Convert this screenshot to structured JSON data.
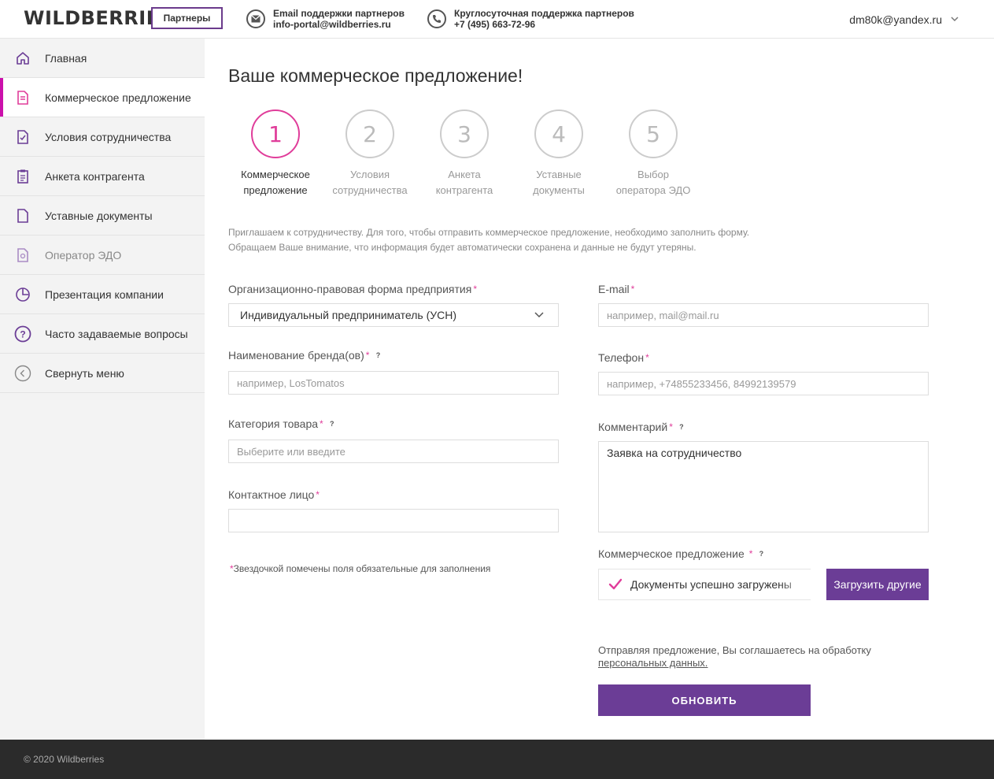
{
  "header": {
    "logo": "WILDBERRIES",
    "partners_label": "Партнеры",
    "email_title": "Email поддержки партнеров",
    "email_value": "info-portal@wildberries.ru",
    "phone_title": "Круглосуточная поддержка партнеров",
    "phone_value": "+7 (495) 663-72-96",
    "user": "dm80k@yandex.ru"
  },
  "sidebar": {
    "items": [
      {
        "label": "Главная",
        "icon": "home-icon"
      },
      {
        "label": "Коммерческое предложение",
        "icon": "document-icon"
      },
      {
        "label": "Условия сотрудничества",
        "icon": "checklist-icon"
      },
      {
        "label": "Анкета контрагента",
        "icon": "clipboard-icon"
      },
      {
        "label": "Уставные документы",
        "icon": "file-icon"
      },
      {
        "label": "Оператор ЭДО",
        "icon": "edo-icon"
      },
      {
        "label": "Презентация компании",
        "icon": "pie-chart-icon"
      },
      {
        "label": "Часто задаваемые вопросы",
        "icon": "question-icon"
      },
      {
        "label": "Свернуть меню",
        "icon": "collapse-icon"
      }
    ]
  },
  "main": {
    "title": "Ваше коммерческое предложение!",
    "steps": [
      {
        "num": "1",
        "line1": "Коммерческое",
        "line2": "предложение"
      },
      {
        "num": "2",
        "line1": "Условия",
        "line2": "сотрудничества"
      },
      {
        "num": "3",
        "line1": "Анкета",
        "line2": "контрагента"
      },
      {
        "num": "4",
        "line1": "Уставные",
        "line2": "документы"
      },
      {
        "num": "5",
        "line1": "Выбор",
        "line2": "оператора ЭДО"
      }
    ],
    "intro_line1": "Приглашаем к сотрудничеству. Для того, чтобы отправить коммерческое предложение, необходимо заполнить форму.",
    "intro_line2": "Обращаем Ваше внимание, что информация будет автоматически сохранена и данные не будут утеряны."
  },
  "form": {
    "org_form_label": "Организационно-правовая форма предприятия",
    "org_form_value": "Индивидуальный предприниматель (УСН)",
    "brand_label": "Наименование бренда(ов)",
    "brand_placeholder": "например, LosTomatos",
    "category_label": "Категория товара",
    "category_placeholder": "Выберите или введите",
    "contact_label": "Контактное лицо",
    "contact_value": "",
    "email_label": "E-mail",
    "email_placeholder": "например, mail@mail.ru",
    "phone_label": "Телефон",
    "phone_placeholder": "например, +74855233456, 84992139579",
    "comment_label": "Комментарий",
    "comment_value": "Заявка на сотрудничество",
    "offer_label": "Коммерческое предложение",
    "offer_status": "Документы успешно загружены",
    "upload_other": "Загрузить другие",
    "required_star": "*",
    "help_mark": "?",
    "required_note": "Звездочкой помечены поля обязательные для заполнения",
    "consent_text": "Отправляя предложение, Вы соглашаетесь на обработку",
    "consent_link": "персональных данных.",
    "submit": "ОБНОВИТЬ"
  },
  "footer": {
    "copyright": "© 2020 Wildberries"
  },
  "colors": {
    "accent": "#6b3d96",
    "pink": "#e03d9a",
    "footer_bg": "#2b2b2b"
  }
}
